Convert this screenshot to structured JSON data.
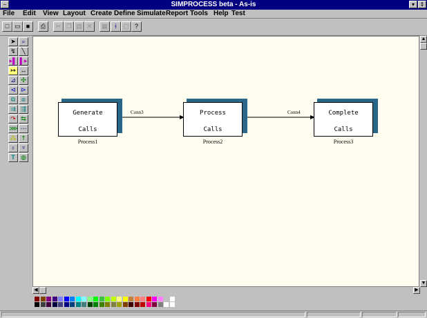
{
  "window": {
    "title": "SIMPROCESS beta - As-is"
  },
  "menu": [
    "File",
    "Edit",
    "View",
    "Layout",
    "Create",
    "Define",
    "Simulate",
    "Report",
    "Tools",
    "Help",
    "Test"
  ],
  "toolbar": {
    "new_icon": "new-document-icon",
    "open_icon": "open-folder-icon",
    "save_icon": "save-icon",
    "print_icon": "print-icon",
    "cut_icon": "cut-icon",
    "copy_icon": "copy-icon",
    "paste_icon": "paste-icon",
    "delete_icon": "delete-icon",
    "properties_icon": "properties-icon",
    "run_icon": "run-icon",
    "view_icon": "view-icon",
    "help_icon": "help-icon"
  },
  "diagram": {
    "processes": [
      {
        "line1": "Generate",
        "line2": "Calls",
        "label": "Process1"
      },
      {
        "line1": "Process",
        "line2": "Calls",
        "label": "Process2"
      },
      {
        "line1": "Complete",
        "line2": "Calls",
        "label": "Process3"
      }
    ],
    "connectors": [
      {
        "label": "Conn3"
      },
      {
        "label": "Conn4"
      }
    ]
  },
  "colors": {
    "row1": [
      "#800000",
      "#804000",
      "#800080",
      "#400080",
      "#8080ff",
      "#0000ff",
      "#0080ff",
      "#00ffff",
      "#80ffff",
      "#80ff80",
      "#00ff00",
      "#40c040",
      "#80ff00",
      "#c0ff00",
      "#ffff80",
      "#ffff00",
      "#c08040",
      "#ff8040",
      "#ff8080",
      "#ff0000",
      "#ff00ff",
      "#ff80ff",
      "#c0c0c0",
      "#ffffff"
    ],
    "row2": [
      "#000000",
      "#404040",
      "#400040",
      "#000040",
      "#404080",
      "#000080",
      "#004080",
      "#008080",
      "#408080",
      "#004000",
      "#008000",
      "#408000",
      "#808000",
      "#808040",
      "#a0a000",
      "#804000",
      "#400000",
      "#800000",
      "#c00000",
      "#ff0080",
      "#800040",
      "#808080",
      "#ffffff",
      "#ffffff"
    ]
  }
}
